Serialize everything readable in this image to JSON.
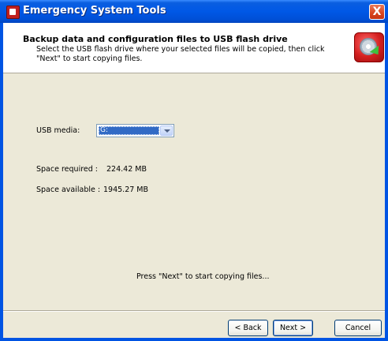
{
  "window": {
    "title": "Emergency System Tools",
    "close_label": "X"
  },
  "header": {
    "title": "Backup data and configuration files to USB flash drive",
    "subtitle": "Select the USB flash drive where your selected files will be copied, then click \"Next\" to start copying files.",
    "icon": "usb-backup-icon"
  },
  "form": {
    "usb_media_label": "USB media:",
    "usb_media_value": "G:",
    "space_required_label": "Space required :",
    "space_required_value": "224.42 MB",
    "space_available_label": "Space available :",
    "space_available_value": "1945.27 MB"
  },
  "instruction": "Press \"Next\" to start copying files...",
  "buttons": {
    "back": "< Back",
    "next": "Next >",
    "cancel": "Cancel"
  },
  "colors": {
    "titlebar": "#0058e6",
    "dialog_bg": "#ece9d8",
    "selection": "#316ac5"
  }
}
